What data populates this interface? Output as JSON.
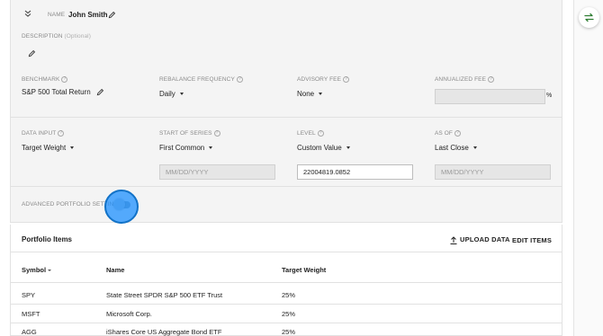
{
  "portfolio": {
    "name_label": "NAME",
    "name_value": "John Smith",
    "description_label": "DESCRIPTION",
    "description_optional": "(Optional)"
  },
  "fields": {
    "benchmark": {
      "label": "BENCHMARK",
      "value": "S&P 500 Total Return"
    },
    "rebalance_frequency": {
      "label": "REBALANCE FREQUENCY",
      "value": "Daily"
    },
    "advisory_fee": {
      "label": "ADVISORY FEE",
      "value": "None"
    },
    "annualized_fee": {
      "label": "ANNUALIZED FEE",
      "value": "",
      "suffix": "%"
    },
    "data_input": {
      "label": "DATA INPUT",
      "value": "Target Weight"
    },
    "start_of_series": {
      "label": "START OF SERIES",
      "value": "First Common",
      "date_placeholder": "MM/DD/YYYY"
    },
    "level": {
      "label": "LEVEL",
      "value": "Custom Value",
      "input_value": "22004819.0852"
    },
    "as_of": {
      "label": "AS OF",
      "value": "Last Close",
      "date_placeholder": "MM/DD/YYYY"
    },
    "help_glyph": "?"
  },
  "advanced": {
    "label": "ADVANCED PORTFOLIO SETTINGS",
    "enabled": false
  },
  "items": {
    "title": "Portfolio Items",
    "upload_label": "UPLOAD DATA",
    "edit_label": "EDIT ITEMS",
    "columns": [
      "Symbol",
      "Name",
      "Target Weight"
    ],
    "rows": [
      {
        "symbol": "SPY",
        "name": "State Street SPDR S&P 500 ETF Trust",
        "weight": "25%"
      },
      {
        "symbol": "MSFT",
        "name": "Microsoft Corp.",
        "weight": "25%"
      },
      {
        "symbol": "AGG",
        "name": "iShares Core US Aggregate Bond ETF",
        "weight": "25%"
      }
    ]
  },
  "colors": {
    "panel_bg": "#f4f4f4",
    "highlight": "#1e90ff",
    "sync_icon": "#2e7d32"
  },
  "icons": [
    "collapse-chevrons-icon",
    "pencil-icon",
    "caret-down-icon",
    "help-icon",
    "upload-icon",
    "sort-caret-icon",
    "sync-icon"
  ]
}
